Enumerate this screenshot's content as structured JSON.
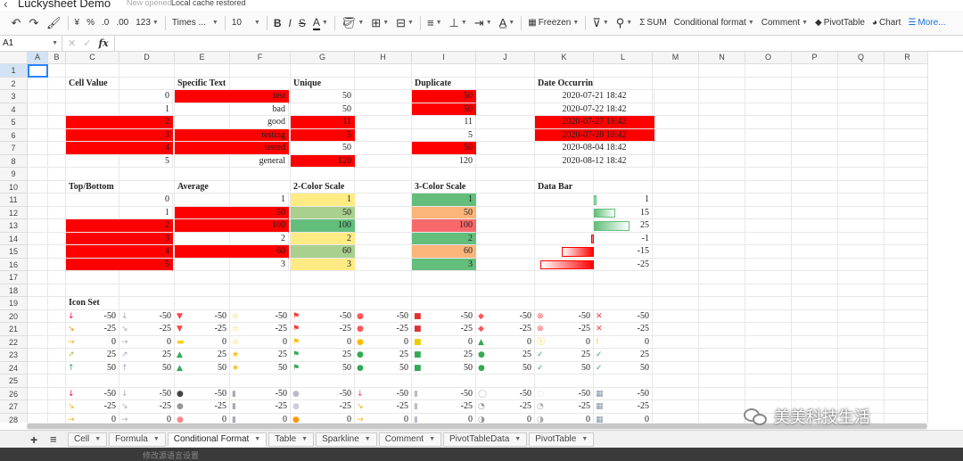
{
  "window": {
    "title": "Luckysheet Demo",
    "status_opened": "New opened",
    "status_cache": "Local cache restored"
  },
  "toolbar": {
    "undo_icon": "undo-icon",
    "redo_icon": "redo-icon",
    "paint_icon": "paint-format-icon",
    "currency": "¥",
    "percent": "%",
    "dec_less": ".0",
    "dec_more": ".00",
    "num_format": "123",
    "font_family": "Times ...",
    "font_size": "10",
    "bold": "B",
    "italic": "I",
    "strike": "S",
    "text_color": "A",
    "freeze": "Freezen",
    "sum": "SUM",
    "conditional_format": "Conditional format",
    "comment": "Comment",
    "pivot_table": "PivotTable",
    "chart": "Chart",
    "more": "More..."
  },
  "formula_bar": {
    "cell_ref": "A1",
    "fx": "fx",
    "value": ""
  },
  "columns": [
    "A",
    "B",
    "C",
    "D",
    "E",
    "F",
    "G",
    "H",
    "I",
    "J",
    "K",
    "L",
    "M",
    "N",
    "O",
    "P",
    "Q",
    "R"
  ],
  "column_widths": [
    23,
    20,
    60,
    62,
    62,
    68,
    72,
    64,
    72,
    66,
    66,
    66,
    52,
    52,
    52,
    52,
    52,
    52
  ],
  "row_numbers": [
    "1",
    "2",
    "3",
    "4",
    "5",
    "6",
    "7",
    "8",
    "9",
    "10",
    "11",
    "12",
    "13",
    "14",
    "15",
    "16",
    "17",
    "18",
    "19",
    "20",
    "21",
    "22",
    "23",
    "24",
    "25",
    "26",
    "27",
    "28"
  ],
  "headers": {
    "r2": [
      "Cell Value",
      "Specific Text",
      "Unique",
      "Duplicate",
      "Date Occurring"
    ],
    "r10": [
      "Top/Bottom",
      "Average",
      "2-Color Scale",
      "3-Color Scale",
      "Data Bar"
    ],
    "r19": "Icon Set"
  },
  "block1": {
    "cell_value": [
      "0",
      "1",
      "2",
      "3",
      "4",
      "5"
    ],
    "specific_text": [
      "test",
      "bad",
      "good",
      "testing",
      "tested",
      "general"
    ],
    "unique": [
      "50",
      "50",
      "11",
      "5",
      "50",
      "120"
    ],
    "duplicate": [
      "50",
      "50",
      "11",
      "5",
      "50",
      "120"
    ],
    "date_occurring": [
      "2020-07-21 18:42",
      "2020-07-22 18:42",
      "2020-07-27 18:42",
      "2020-07-28 18:42",
      "2020-08-04 18:42",
      "2020-08-12 18:42"
    ]
  },
  "block2": {
    "top_bottom": [
      "0",
      "1",
      "2",
      "3",
      "4",
      "5"
    ],
    "average": [
      "1",
      "50",
      "100",
      "2",
      "60",
      "3"
    ],
    "two_color": [
      "1",
      "50",
      "100",
      "2",
      "60",
      "3"
    ],
    "three_color": [
      "1",
      "50",
      "100",
      "2",
      "60",
      "3"
    ],
    "data_bar": [
      "1",
      "15",
      "25",
      "-1",
      "-15",
      "-25"
    ],
    "data_bar_levels": [
      0.04,
      0.6,
      1.0,
      -0.04,
      -0.6,
      -1.0
    ]
  },
  "icon_set_values": {
    "rows_a": [
      "-50",
      "-25",
      "0",
      "25",
      "50"
    ],
    "rows_b": [
      "-50",
      "-25",
      "0"
    ]
  },
  "colors": {
    "highlight_red": "#ff0000",
    "cs_green": "#63be7b",
    "cs_lightgreen": "#a9d08e",
    "cs_yellow": "#ffeb84",
    "cs_red": "#f8696b",
    "cs_orange": "#fbb47a",
    "databar_green": "#63be7b",
    "databar_red": "#ff0000"
  },
  "sheet_tabs": [
    "Cell",
    "Formula",
    "Conditional Format",
    "Table",
    "Sparkline",
    "Comment",
    "PivotTableData",
    "PivotTable"
  ],
  "active_tab": "Conditional Format",
  "bottom_hint": "修改源语言设置",
  "watermark": "美美科技生活"
}
